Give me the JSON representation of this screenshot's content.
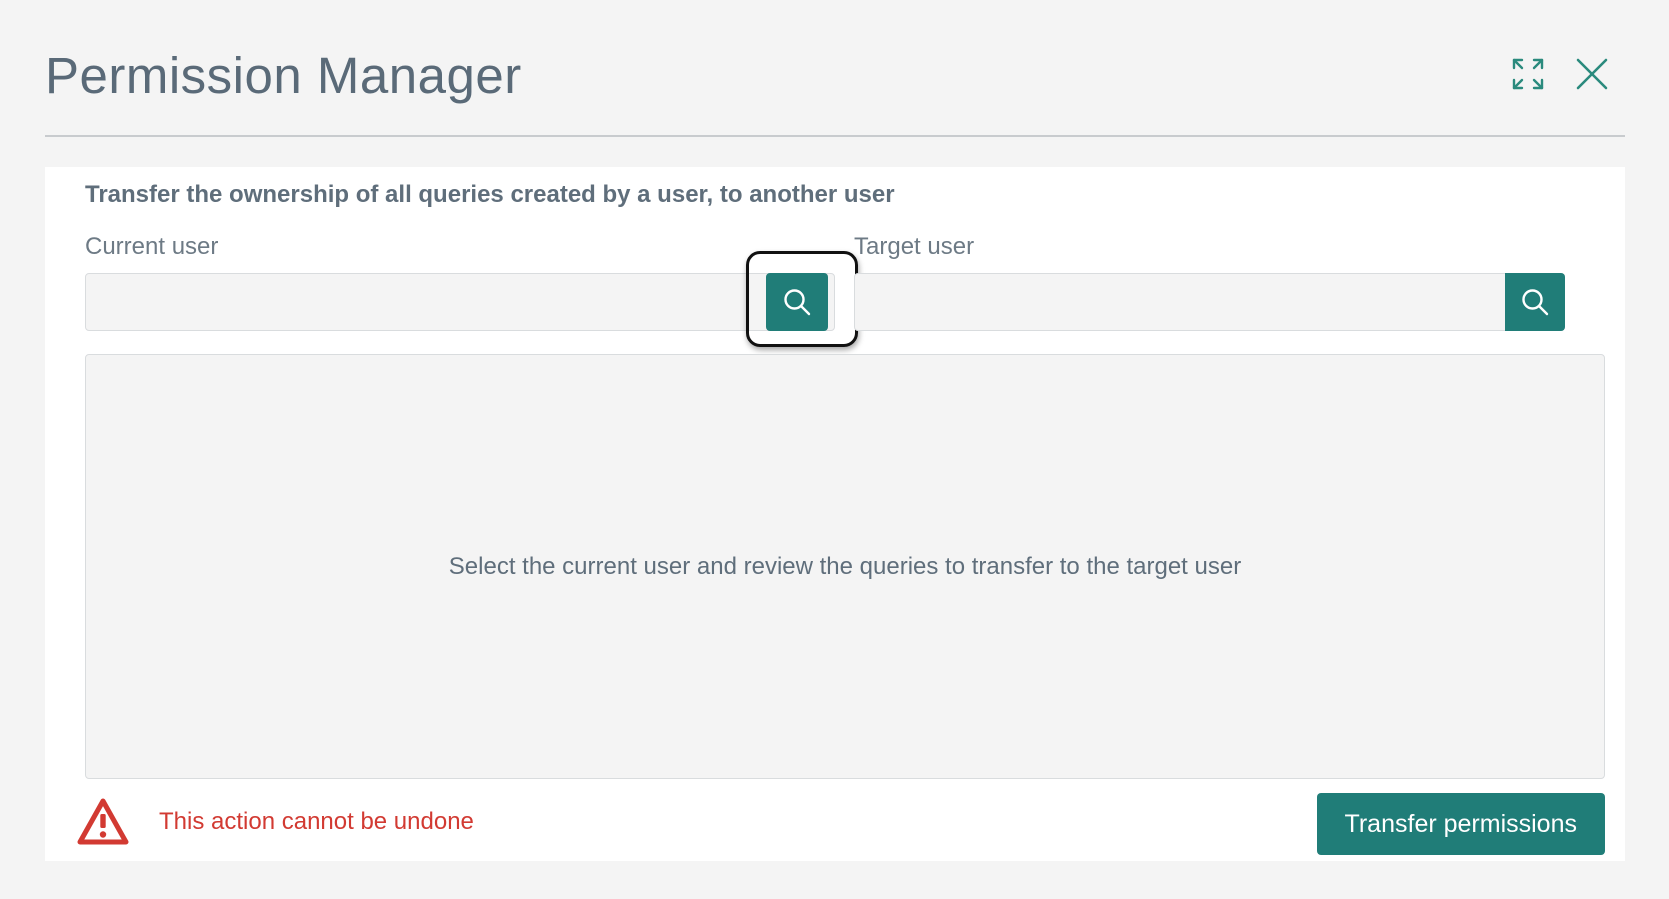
{
  "dialog": {
    "title": "Permission Manager",
    "expand_icon": "expand-arrows-icon",
    "close_icon": "close-x-icon"
  },
  "panel": {
    "description": "Transfer the ownership of all queries created by a user, to another user",
    "current_user": {
      "label": "Current user",
      "value": "",
      "search_icon": "search-icon"
    },
    "target_user": {
      "label": "Target user",
      "value": "",
      "search_icon": "search-icon"
    },
    "results": {
      "empty_message": "Select the current user and review the queries to transfer to the target user"
    },
    "footer": {
      "warning_icon": "warning-triangle-icon",
      "warning_text": "This action cannot be undone",
      "transfer_label": "Transfer permissions"
    }
  },
  "colors": {
    "accent": "#207d78",
    "title": "#5a6a78",
    "warning": "#d23a32",
    "background": "#f4f4f4",
    "panel": "#ffffff"
  }
}
